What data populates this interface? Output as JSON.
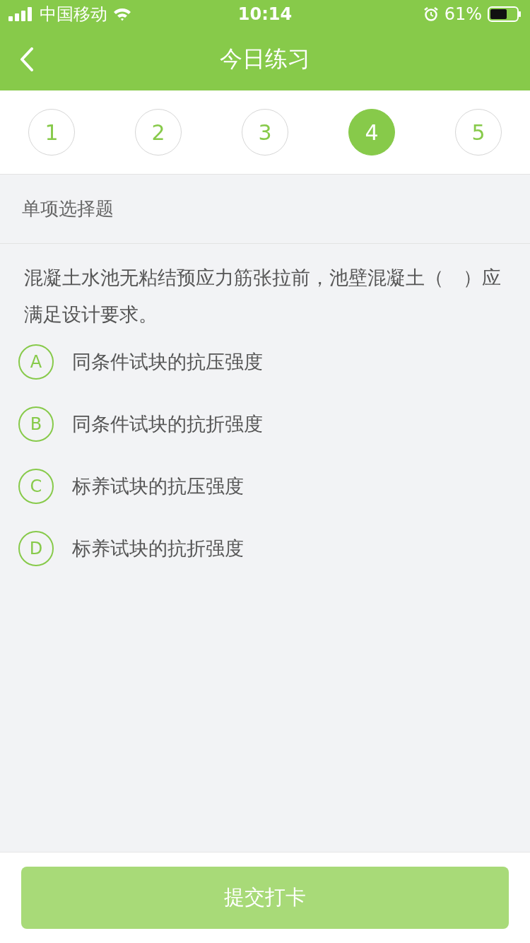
{
  "status_bar": {
    "carrier": "中国移动",
    "time": "10:14",
    "battery": "61%"
  },
  "nav_bar": {
    "title": "今日练习"
  },
  "question_tabs": [
    {
      "label": "1",
      "selected": false
    },
    {
      "label": "2",
      "selected": false
    },
    {
      "label": "3",
      "selected": false
    },
    {
      "label": "4",
      "selected": true
    },
    {
      "label": "5",
      "selected": false
    }
  ],
  "section_title": "单项选择题",
  "question": {
    "text": "混凝土水池无粘结预应力筋张拉前，池壁混凝土（　）应满足设计要求。",
    "options": [
      {
        "letter": "A",
        "text": "同条件试块的抗压强度",
        "selected": false
      },
      {
        "letter": "B",
        "text": "同条件试块的抗折强度",
        "selected": false
      },
      {
        "letter": "C",
        "text": "标养试块的抗压强度",
        "selected": false
      },
      {
        "letter": "D",
        "text": "标养试块的抗折强度",
        "selected": false
      }
    ]
  },
  "submit_button": {
    "label": "提交打卡",
    "disabled": true
  }
}
